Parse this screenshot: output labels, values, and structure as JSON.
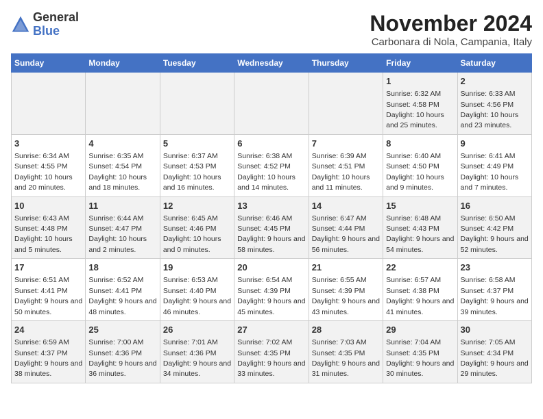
{
  "header": {
    "logo_general": "General",
    "logo_blue": "Blue",
    "month_title": "November 2024",
    "location": "Carbonara di Nola, Campania, Italy"
  },
  "days_of_week": [
    "Sunday",
    "Monday",
    "Tuesday",
    "Wednesday",
    "Thursday",
    "Friday",
    "Saturday"
  ],
  "weeks": [
    {
      "days": [
        {
          "num": "",
          "info": ""
        },
        {
          "num": "",
          "info": ""
        },
        {
          "num": "",
          "info": ""
        },
        {
          "num": "",
          "info": ""
        },
        {
          "num": "",
          "info": ""
        },
        {
          "num": "1",
          "info": "Sunrise: 6:32 AM\nSunset: 4:58 PM\nDaylight: 10 hours and 25 minutes."
        },
        {
          "num": "2",
          "info": "Sunrise: 6:33 AM\nSunset: 4:56 PM\nDaylight: 10 hours and 23 minutes."
        }
      ]
    },
    {
      "days": [
        {
          "num": "3",
          "info": "Sunrise: 6:34 AM\nSunset: 4:55 PM\nDaylight: 10 hours and 20 minutes."
        },
        {
          "num": "4",
          "info": "Sunrise: 6:35 AM\nSunset: 4:54 PM\nDaylight: 10 hours and 18 minutes."
        },
        {
          "num": "5",
          "info": "Sunrise: 6:37 AM\nSunset: 4:53 PM\nDaylight: 10 hours and 16 minutes."
        },
        {
          "num": "6",
          "info": "Sunrise: 6:38 AM\nSunset: 4:52 PM\nDaylight: 10 hours and 14 minutes."
        },
        {
          "num": "7",
          "info": "Sunrise: 6:39 AM\nSunset: 4:51 PM\nDaylight: 10 hours and 11 minutes."
        },
        {
          "num": "8",
          "info": "Sunrise: 6:40 AM\nSunset: 4:50 PM\nDaylight: 10 hours and 9 minutes."
        },
        {
          "num": "9",
          "info": "Sunrise: 6:41 AM\nSunset: 4:49 PM\nDaylight: 10 hours and 7 minutes."
        }
      ]
    },
    {
      "days": [
        {
          "num": "10",
          "info": "Sunrise: 6:43 AM\nSunset: 4:48 PM\nDaylight: 10 hours and 5 minutes."
        },
        {
          "num": "11",
          "info": "Sunrise: 6:44 AM\nSunset: 4:47 PM\nDaylight: 10 hours and 2 minutes."
        },
        {
          "num": "12",
          "info": "Sunrise: 6:45 AM\nSunset: 4:46 PM\nDaylight: 10 hours and 0 minutes."
        },
        {
          "num": "13",
          "info": "Sunrise: 6:46 AM\nSunset: 4:45 PM\nDaylight: 9 hours and 58 minutes."
        },
        {
          "num": "14",
          "info": "Sunrise: 6:47 AM\nSunset: 4:44 PM\nDaylight: 9 hours and 56 minutes."
        },
        {
          "num": "15",
          "info": "Sunrise: 6:48 AM\nSunset: 4:43 PM\nDaylight: 9 hours and 54 minutes."
        },
        {
          "num": "16",
          "info": "Sunrise: 6:50 AM\nSunset: 4:42 PM\nDaylight: 9 hours and 52 minutes."
        }
      ]
    },
    {
      "days": [
        {
          "num": "17",
          "info": "Sunrise: 6:51 AM\nSunset: 4:41 PM\nDaylight: 9 hours and 50 minutes."
        },
        {
          "num": "18",
          "info": "Sunrise: 6:52 AM\nSunset: 4:41 PM\nDaylight: 9 hours and 48 minutes."
        },
        {
          "num": "19",
          "info": "Sunrise: 6:53 AM\nSunset: 4:40 PM\nDaylight: 9 hours and 46 minutes."
        },
        {
          "num": "20",
          "info": "Sunrise: 6:54 AM\nSunset: 4:39 PM\nDaylight: 9 hours and 45 minutes."
        },
        {
          "num": "21",
          "info": "Sunrise: 6:55 AM\nSunset: 4:39 PM\nDaylight: 9 hours and 43 minutes."
        },
        {
          "num": "22",
          "info": "Sunrise: 6:57 AM\nSunset: 4:38 PM\nDaylight: 9 hours and 41 minutes."
        },
        {
          "num": "23",
          "info": "Sunrise: 6:58 AM\nSunset: 4:37 PM\nDaylight: 9 hours and 39 minutes."
        }
      ]
    },
    {
      "days": [
        {
          "num": "24",
          "info": "Sunrise: 6:59 AM\nSunset: 4:37 PM\nDaylight: 9 hours and 38 minutes."
        },
        {
          "num": "25",
          "info": "Sunrise: 7:00 AM\nSunset: 4:36 PM\nDaylight: 9 hours and 36 minutes."
        },
        {
          "num": "26",
          "info": "Sunrise: 7:01 AM\nSunset: 4:36 PM\nDaylight: 9 hours and 34 minutes."
        },
        {
          "num": "27",
          "info": "Sunrise: 7:02 AM\nSunset: 4:35 PM\nDaylight: 9 hours and 33 minutes."
        },
        {
          "num": "28",
          "info": "Sunrise: 7:03 AM\nSunset: 4:35 PM\nDaylight: 9 hours and 31 minutes."
        },
        {
          "num": "29",
          "info": "Sunrise: 7:04 AM\nSunset: 4:35 PM\nDaylight: 9 hours and 30 minutes."
        },
        {
          "num": "30",
          "info": "Sunrise: 7:05 AM\nSunset: 4:34 PM\nDaylight: 9 hours and 29 minutes."
        }
      ]
    }
  ]
}
